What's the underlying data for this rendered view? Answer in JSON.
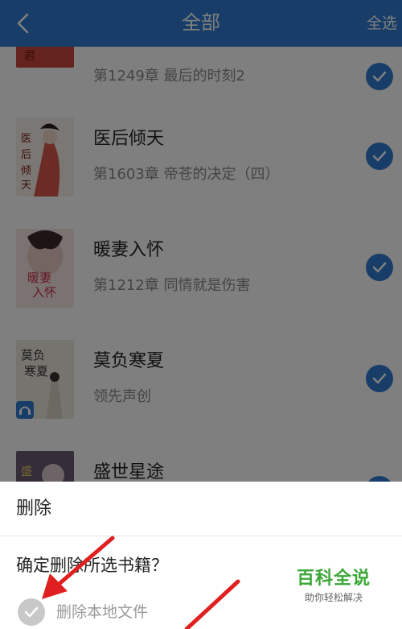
{
  "header": {
    "title": "全部",
    "select_all": "全选"
  },
  "books": [
    {
      "title": "",
      "chapter": "第1249章 最后的时刻2",
      "checked": true,
      "cover_color": "#c9473a",
      "cover_text": "君"
    },
    {
      "title": "医后倾天",
      "chapter": "第1603章 帝苍的决定（四）",
      "checked": true,
      "cover_color": "#d9584a",
      "cover_text": "医后倾天"
    },
    {
      "title": "暖妻入怀",
      "chapter": "第1212章 同情就是伤害",
      "checked": true,
      "cover_color": "#f1dede",
      "cover_text": "暖妻入怀"
    },
    {
      "title": "莫负寒夏",
      "chapter": "领先声创",
      "checked": true,
      "cover_color": "#e8e4dc",
      "cover_text": "莫负寒夏"
    },
    {
      "title": "盛世星途",
      "chapter": "",
      "checked": true,
      "cover_color": "#6a5a6e",
      "cover_text": "盛世"
    }
  ],
  "dialog": {
    "title": "删除",
    "confirm_text": "确定删除所选书籍？",
    "option_label": "删除本地文件"
  },
  "watermark": {
    "title": "百科全说",
    "subtitle": "助你轻松解决"
  },
  "colors": {
    "primary": "#2f7bd0",
    "overlay": "rgba(0,0,0,0.5)",
    "watermark": "#3aa836"
  }
}
